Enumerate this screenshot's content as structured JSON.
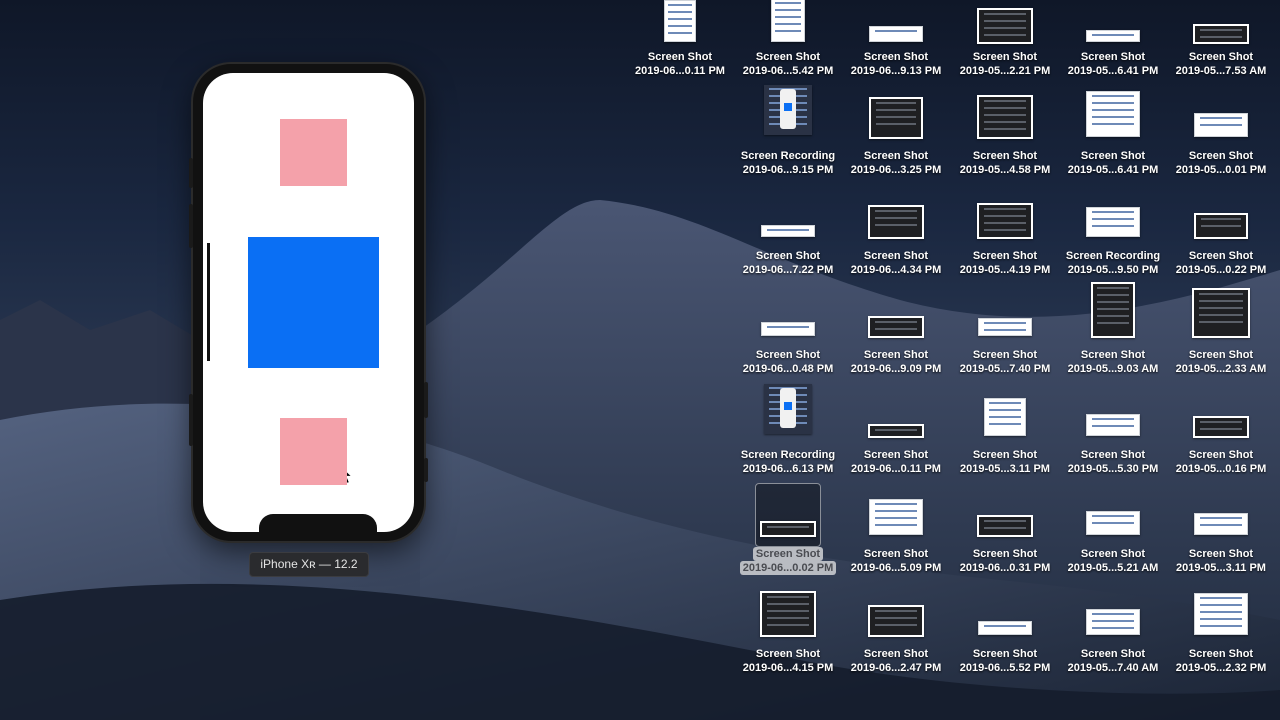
{
  "simulator": {
    "device_label": "iPhone Xʀ — 12.2",
    "colors": {
      "pink": "#f4a1aa",
      "blue": "#0a6ff4"
    }
  },
  "desktop": {
    "icons": [
      {
        "name": "Screen Shot",
        "date": "2019-06...0.11 PM"
      },
      {
        "name": "Screen Shot",
        "date": "2019-06...5.42 PM"
      },
      {
        "name": "Screen Shot",
        "date": "2019-06...9.13 PM"
      },
      {
        "name": "Screen Shot",
        "date": "2019-05...2.21 PM"
      },
      {
        "name": "Screen Shot",
        "date": "2019-05...6.41 PM"
      },
      {
        "name": "Screen Shot",
        "date": "2019-05...7.53 AM"
      },
      {
        "name": "Screen Recording",
        "date": "2019-06...9.15 PM"
      },
      {
        "name": "Screen Shot",
        "date": "2019-06...3.25 PM"
      },
      {
        "name": "Screen Shot",
        "date": "2019-05...4.58 PM"
      },
      {
        "name": "Screen Shot",
        "date": "2019-05...6.41 PM"
      },
      {
        "name": "Screen Shot",
        "date": "2019-05...0.01 PM"
      },
      {
        "name": "Screen Shot",
        "date": "2019-06...7.22 PM"
      },
      {
        "name": "Screen Shot",
        "date": "2019-06...4.34 PM"
      },
      {
        "name": "Screen Shot",
        "date": "2019-05...4.19 PM"
      },
      {
        "name": "Screen Recording",
        "date": "2019-05...9.50 PM"
      },
      {
        "name": "Screen Shot",
        "date": "2019-05...0.22 PM"
      },
      {
        "name": "Screen Shot",
        "date": "2019-06...0.48 PM"
      },
      {
        "name": "Screen Shot",
        "date": "2019-06...9.09 PM"
      },
      {
        "name": "Screen Shot",
        "date": "2019-05...7.40 PM"
      },
      {
        "name": "Screen Shot",
        "date": "2019-05...9.03 AM"
      },
      {
        "name": "Screen Shot",
        "date": "2019-05...2.33 AM"
      },
      {
        "name": "Screen Recording",
        "date": "2019-06...6.13 PM"
      },
      {
        "name": "Screen Shot",
        "date": "2019-06...0.11 PM"
      },
      {
        "name": "Screen Shot",
        "date": "2019-05...3.11 PM"
      },
      {
        "name": "Screen Shot",
        "date": "2019-05...5.30 PM"
      },
      {
        "name": "Screen Shot",
        "date": "2019-05...0.16 PM"
      },
      {
        "name": "Screen Shot",
        "date": "2019-06...0.02 PM",
        "selected": true
      },
      {
        "name": "Screen Shot",
        "date": "2019-06...5.09 PM"
      },
      {
        "name": "Screen Shot",
        "date": "2019-06...0.31 PM"
      },
      {
        "name": "Screen Shot",
        "date": "2019-05...5.21 AM"
      },
      {
        "name": "Screen Shot",
        "date": "2019-05...3.11 PM"
      },
      {
        "name": "Screen Shot",
        "date": "2019-06...4.15 PM"
      },
      {
        "name": "Screen Shot",
        "date": "2019-06...2.47 PM"
      },
      {
        "name": "Screen Shot",
        "date": "2019-06...5.52 PM"
      },
      {
        "name": "Screen Shot",
        "date": "2019-05...7.40 AM"
      },
      {
        "name": "Screen Shot",
        "date": "2019-05...2.32 PM"
      }
    ]
  }
}
